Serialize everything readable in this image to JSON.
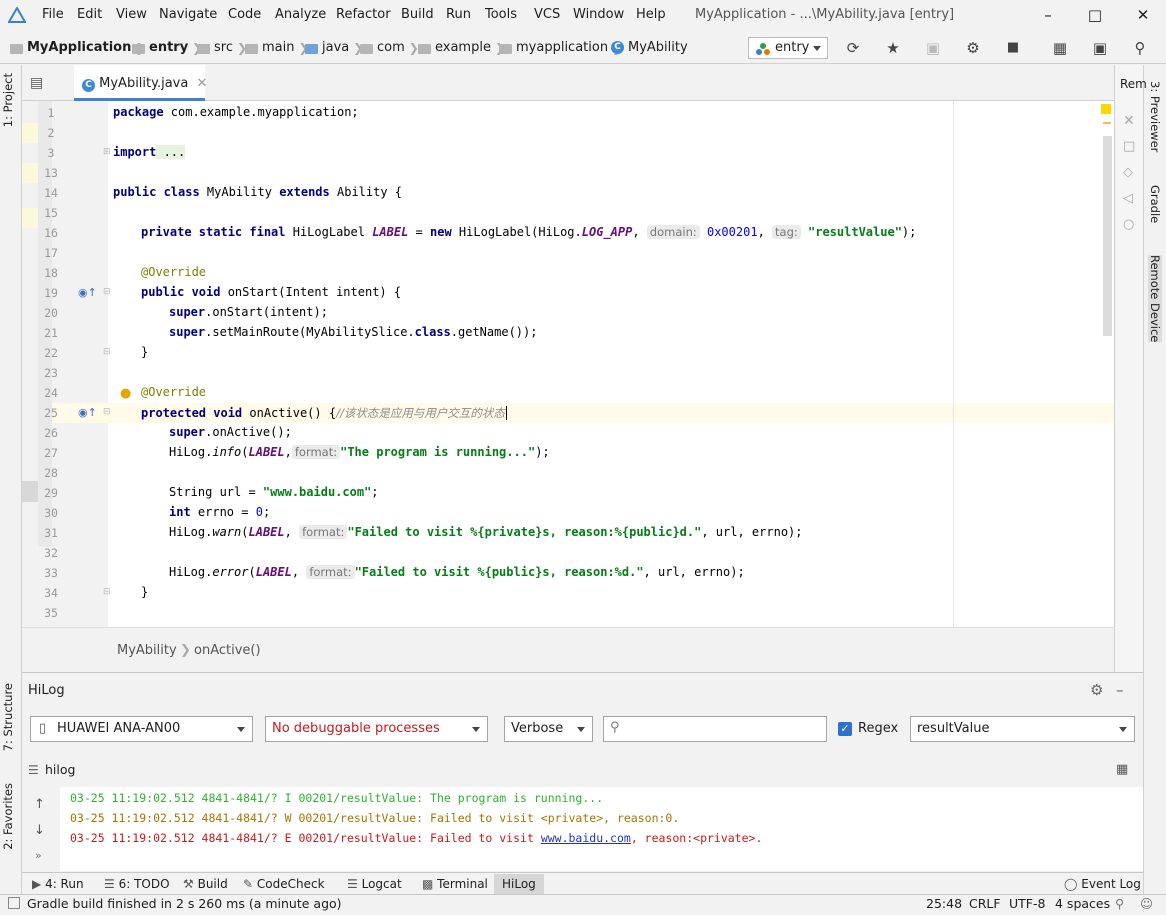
{
  "menu": {
    "items": [
      "File",
      "Edit",
      "View",
      "Navigate",
      "Code",
      "Analyze",
      "Refactor",
      "Build",
      "Run",
      "Tools",
      "VCS",
      "Window",
      "Help"
    ],
    "window_title": "MyApplication - ...\\MyAbility.java [entry]"
  },
  "breadcrumb": {
    "project": "MyApplication",
    "parts": [
      "entry",
      "src",
      "main",
      "java",
      "com",
      "example",
      "myapplication",
      "MyAbility"
    ]
  },
  "run_config": "entry",
  "left_tabs": {
    "project": "1: Project",
    "structure": "7: Structure",
    "favorites": "2: Favorites"
  },
  "right_tabs": {
    "previewer": "3: Previewer",
    "gradle": "Gradle",
    "remote": "Remote Device",
    "rem": "Rem"
  },
  "editor": {
    "tab_label": "MyAbility.java",
    "line_numbers": [
      "1",
      "2",
      "3",
      "13",
      "14",
      "15",
      "16",
      "17",
      "18",
      "19",
      "20",
      "21",
      "22",
      "23",
      "24",
      "25",
      "26",
      "27",
      "28",
      "29",
      "30",
      "31",
      "32",
      "33",
      "34",
      "35"
    ],
    "lines": {
      "l1_kw": "package",
      "l1_rest": " com.example.myapplication;",
      "l3_kw": "import",
      "l3_rest": " ...",
      "l14_kw1": "public class",
      "l14_mid": " MyAbility ",
      "l14_kw2": "extends",
      "l14_rest": " Ability {",
      "l16_kw": "private static final",
      "l16_a": " HiLogLabel ",
      "l16_const": "LABEL",
      "l16_b": " = ",
      "l16_new": "new",
      "l16_c": " HiLogLabel(HiLog.",
      "l16_logapp": "LOG_APP",
      "l16_d": ",",
      "l16_hint1": "domain:",
      "l16_num": "0x00201",
      "l16_e": ",",
      "l16_hint2": "tag:",
      "l16_str": "\"resultValue\"",
      "l16_f": ");",
      "l18_ann": "@Override",
      "l19_kw": "public void",
      "l19_rest": " onStart(Intent intent) {",
      "l20_kw": "super",
      "l20_rest": ".onStart(intent);",
      "l21_kw": "super",
      "l21_a": ".setMainRoute(MyAbilitySlice.",
      "l21_kw2": "class",
      "l21_b": ".getName());",
      "l22": "}",
      "l24_ann": "@Override",
      "l25_kw": "protected void",
      "l25_rest": " onActive() {",
      "l25_cm": "//该状态是应用与用户交互的状态",
      "l26_kw": "super",
      "l26_rest": ".onActive();",
      "l27_a": "HiLog.",
      "l27_m": "info",
      "l27_b": "(",
      "l27_const": "LABEL",
      "l27_c": ",",
      "l27_hint": "format:",
      "l27_str": "\"The program is running...\"",
      "l27_d": ");",
      "l29_a": "String url = ",
      "l29_str": "\"www.baidu.com\"",
      "l29_b": ";",
      "l30_kw": "int",
      "l30_a": " errno = ",
      "l30_num": "0",
      "l30_b": ";",
      "l31_a": "HiLog.",
      "l31_m": "warn",
      "l31_b": "(",
      "l31_const": "LABEL",
      "l31_c": ",",
      "l31_hint": "format:",
      "l31_str": "\"Failed to visit %{private}s, reason:%{public}d.\"",
      "l31_d": ", url, errno);",
      "l33_a": "HiLog.",
      "l33_m": "error",
      "l33_b": "(",
      "l33_const": "LABEL",
      "l33_c": ",",
      "l33_hint": "format:",
      "l33_str": "\"Failed to visit %{public}s, reason:%d.\"",
      "l33_d": ", url, errno);",
      "l34": "}"
    }
  },
  "editor_breadcrumb": {
    "class": "MyAbility",
    "method": "onActive()"
  },
  "hilog": {
    "title": "HiLog",
    "device": "HUAWEI ANA-AN00",
    "process": "No debuggable processes",
    "level": "Verbose",
    "search_value": "",
    "regex_label": "Regex",
    "regex_checked": true,
    "filter": "resultValue",
    "tab_label": "hilog",
    "logs": [
      {
        "level": "I",
        "color": "#2fb12f",
        "text": "03-25 11:19:02.512 4841-4841/? I 00201/resultValue: The program is running..."
      },
      {
        "level": "W",
        "color": "#a77400",
        "pre": "03-25 11:19:02.512 4841-4841/? W 00201/resultValue: Failed to visit <private>, reason:0.",
        "text": "03-25 11:19:02.512 4841-4841/? W 00201/resultValue: Failed to visit <private>, reason:0."
      },
      {
        "level": "E",
        "color": "#c81a1a",
        "pre": "03-25 11:19:02.512 4841-4841/? E 00201/resultValue: Failed to visit ",
        "link": "www.baidu.com",
        "post": ", reason:<private>."
      }
    ]
  },
  "bottom_tabs": [
    "4: Run",
    "6: TODO",
    "Build",
    "CodeCheck",
    "Logcat",
    "Terminal",
    "HiLog"
  ],
  "event_log": "Event Log",
  "status": {
    "message": "Gradle build finished in 2 s 260 ms (a minute ago)",
    "position": "25:48",
    "line_sep": "CRLF",
    "encoding": "UTF-8",
    "indent": "4 spaces"
  }
}
